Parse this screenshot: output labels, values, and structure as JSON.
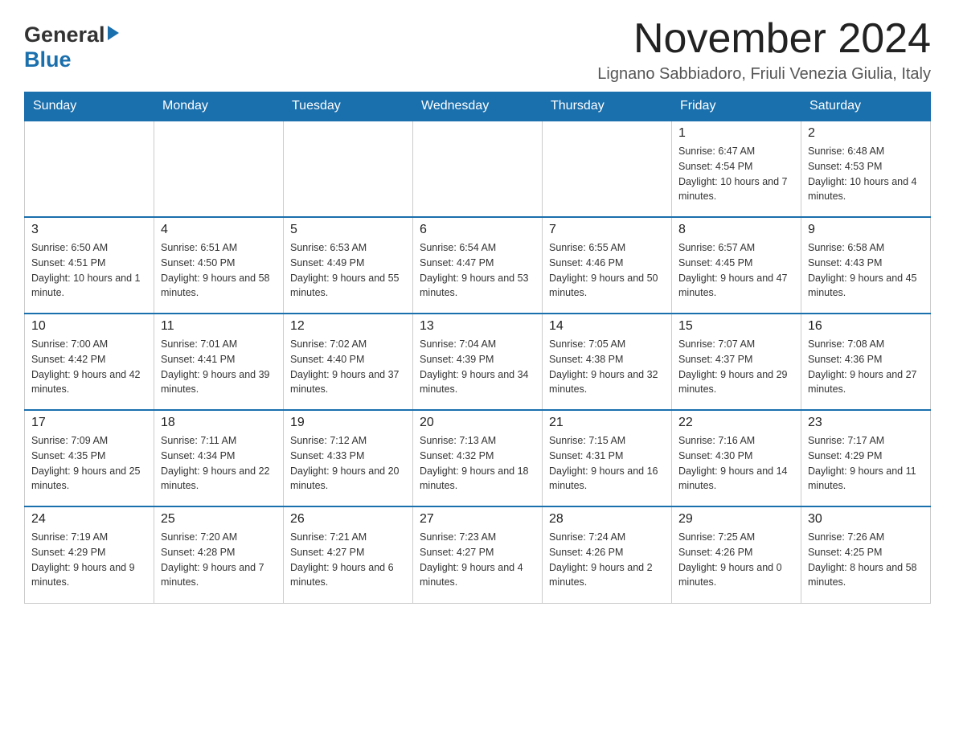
{
  "header": {
    "logo_general": "General",
    "logo_blue": "Blue",
    "month_title": "November 2024",
    "location": "Lignano Sabbiadoro, Friuli Venezia Giulia, Italy"
  },
  "weekdays": [
    "Sunday",
    "Monday",
    "Tuesday",
    "Wednesday",
    "Thursday",
    "Friday",
    "Saturday"
  ],
  "weeks": [
    {
      "days": [
        {
          "number": "",
          "info": ""
        },
        {
          "number": "",
          "info": ""
        },
        {
          "number": "",
          "info": ""
        },
        {
          "number": "",
          "info": ""
        },
        {
          "number": "",
          "info": ""
        },
        {
          "number": "1",
          "info": "Sunrise: 6:47 AM\nSunset: 4:54 PM\nDaylight: 10 hours and 7 minutes."
        },
        {
          "number": "2",
          "info": "Sunrise: 6:48 AM\nSunset: 4:53 PM\nDaylight: 10 hours and 4 minutes."
        }
      ]
    },
    {
      "days": [
        {
          "number": "3",
          "info": "Sunrise: 6:50 AM\nSunset: 4:51 PM\nDaylight: 10 hours and 1 minute."
        },
        {
          "number": "4",
          "info": "Sunrise: 6:51 AM\nSunset: 4:50 PM\nDaylight: 9 hours and 58 minutes."
        },
        {
          "number": "5",
          "info": "Sunrise: 6:53 AM\nSunset: 4:49 PM\nDaylight: 9 hours and 55 minutes."
        },
        {
          "number": "6",
          "info": "Sunrise: 6:54 AM\nSunset: 4:47 PM\nDaylight: 9 hours and 53 minutes."
        },
        {
          "number": "7",
          "info": "Sunrise: 6:55 AM\nSunset: 4:46 PM\nDaylight: 9 hours and 50 minutes."
        },
        {
          "number": "8",
          "info": "Sunrise: 6:57 AM\nSunset: 4:45 PM\nDaylight: 9 hours and 47 minutes."
        },
        {
          "number": "9",
          "info": "Sunrise: 6:58 AM\nSunset: 4:43 PM\nDaylight: 9 hours and 45 minutes."
        }
      ]
    },
    {
      "days": [
        {
          "number": "10",
          "info": "Sunrise: 7:00 AM\nSunset: 4:42 PM\nDaylight: 9 hours and 42 minutes."
        },
        {
          "number": "11",
          "info": "Sunrise: 7:01 AM\nSunset: 4:41 PM\nDaylight: 9 hours and 39 minutes."
        },
        {
          "number": "12",
          "info": "Sunrise: 7:02 AM\nSunset: 4:40 PM\nDaylight: 9 hours and 37 minutes."
        },
        {
          "number": "13",
          "info": "Sunrise: 7:04 AM\nSunset: 4:39 PM\nDaylight: 9 hours and 34 minutes."
        },
        {
          "number": "14",
          "info": "Sunrise: 7:05 AM\nSunset: 4:38 PM\nDaylight: 9 hours and 32 minutes."
        },
        {
          "number": "15",
          "info": "Sunrise: 7:07 AM\nSunset: 4:37 PM\nDaylight: 9 hours and 29 minutes."
        },
        {
          "number": "16",
          "info": "Sunrise: 7:08 AM\nSunset: 4:36 PM\nDaylight: 9 hours and 27 minutes."
        }
      ]
    },
    {
      "days": [
        {
          "number": "17",
          "info": "Sunrise: 7:09 AM\nSunset: 4:35 PM\nDaylight: 9 hours and 25 minutes."
        },
        {
          "number": "18",
          "info": "Sunrise: 7:11 AM\nSunset: 4:34 PM\nDaylight: 9 hours and 22 minutes."
        },
        {
          "number": "19",
          "info": "Sunrise: 7:12 AM\nSunset: 4:33 PM\nDaylight: 9 hours and 20 minutes."
        },
        {
          "number": "20",
          "info": "Sunrise: 7:13 AM\nSunset: 4:32 PM\nDaylight: 9 hours and 18 minutes."
        },
        {
          "number": "21",
          "info": "Sunrise: 7:15 AM\nSunset: 4:31 PM\nDaylight: 9 hours and 16 minutes."
        },
        {
          "number": "22",
          "info": "Sunrise: 7:16 AM\nSunset: 4:30 PM\nDaylight: 9 hours and 14 minutes."
        },
        {
          "number": "23",
          "info": "Sunrise: 7:17 AM\nSunset: 4:29 PM\nDaylight: 9 hours and 11 minutes."
        }
      ]
    },
    {
      "days": [
        {
          "number": "24",
          "info": "Sunrise: 7:19 AM\nSunset: 4:29 PM\nDaylight: 9 hours and 9 minutes."
        },
        {
          "number": "25",
          "info": "Sunrise: 7:20 AM\nSunset: 4:28 PM\nDaylight: 9 hours and 7 minutes."
        },
        {
          "number": "26",
          "info": "Sunrise: 7:21 AM\nSunset: 4:27 PM\nDaylight: 9 hours and 6 minutes."
        },
        {
          "number": "27",
          "info": "Sunrise: 7:23 AM\nSunset: 4:27 PM\nDaylight: 9 hours and 4 minutes."
        },
        {
          "number": "28",
          "info": "Sunrise: 7:24 AM\nSunset: 4:26 PM\nDaylight: 9 hours and 2 minutes."
        },
        {
          "number": "29",
          "info": "Sunrise: 7:25 AM\nSunset: 4:26 PM\nDaylight: 9 hours and 0 minutes."
        },
        {
          "number": "30",
          "info": "Sunrise: 7:26 AM\nSunset: 4:25 PM\nDaylight: 8 hours and 58 minutes."
        }
      ]
    }
  ]
}
